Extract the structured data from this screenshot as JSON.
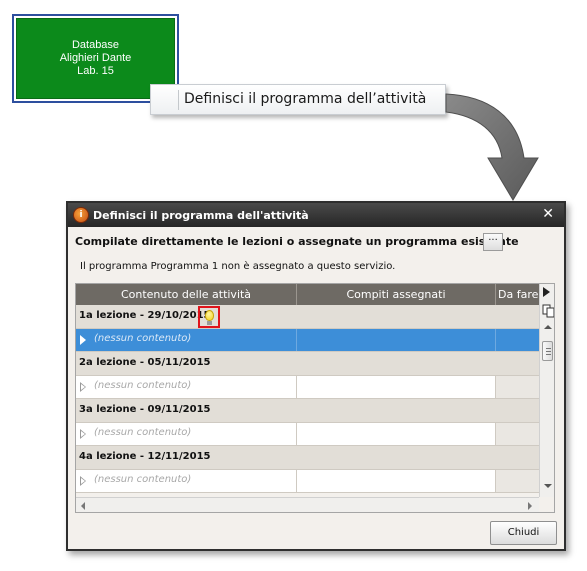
{
  "tile": {
    "lines": [
      "Database",
      "Alighieri Dante",
      "Lab. 15"
    ],
    "color": "#0c8a1b"
  },
  "tooltip": {
    "text": "Definisci il programma dell’attività"
  },
  "dialog": {
    "title": "Definisci il programma dell'attività",
    "close_icon": "✕",
    "instruction": "Compilate direttamente le lezioni o assegnate un programma esistente",
    "more_button": "···",
    "status": "Il programma Programma 1 non è assegnato a questo servizio.",
    "columns": [
      "Contenuto delle attività",
      "Compiti assegnati",
      "Da fare"
    ],
    "lessons": [
      {
        "label": "1a lezione - 29/10/2015",
        "content": "(nessun contenuto)",
        "selected": true,
        "has_bulb": true
      },
      {
        "label": "2a lezione - 05/11/2015",
        "content": "(nessun contenuto)",
        "selected": false,
        "has_bulb": false
      },
      {
        "label": "3a lezione - 09/11/2015",
        "content": "(nessun contenuto)",
        "selected": false,
        "has_bulb": false
      },
      {
        "label": "4a lezione - 12/11/2015",
        "content": "(nessun contenuto)",
        "selected": false,
        "has_bulb": false
      }
    ],
    "close_button": "Chiudi",
    "selection_color": "#3d8ed8"
  }
}
